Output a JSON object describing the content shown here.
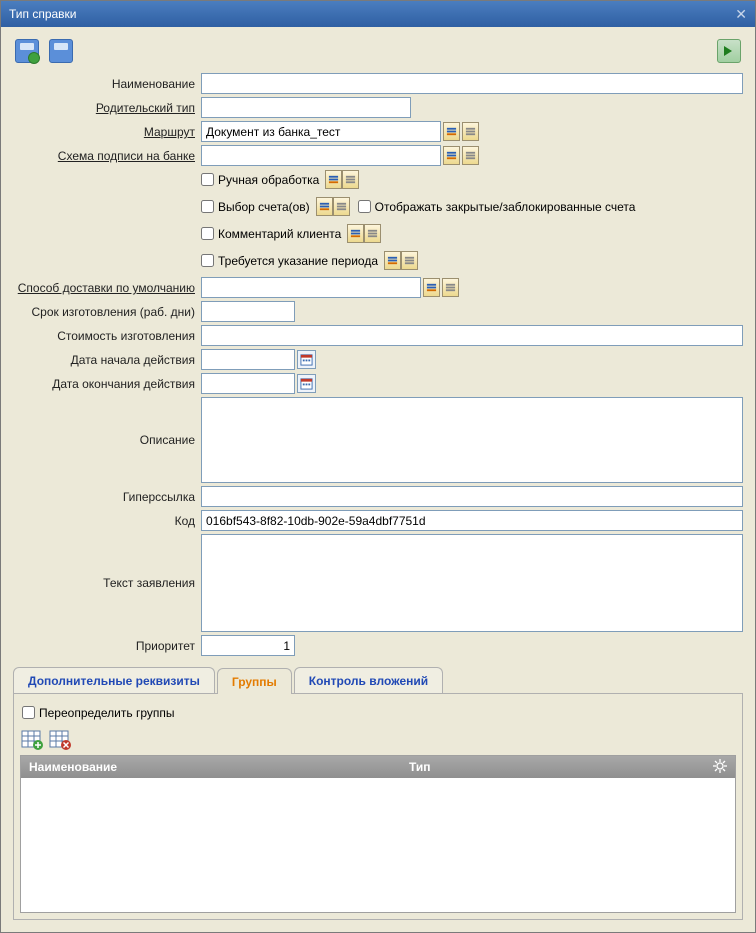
{
  "window": {
    "title": "Тип справки"
  },
  "labels": {
    "name": "Наименование",
    "parent_type": "Родительский тип",
    "route": "Маршрут",
    "signature_scheme": "Схема подписи на банке",
    "manual_processing": "Ручная обработка",
    "account_selection": "Выбор счета(ов)",
    "show_closed": "Отображать закрытые/заблокированные счета",
    "client_comment": "Комментарий клиента",
    "period_required": "Требуется указание периода",
    "delivery_method": "Способ доставки по умолчанию",
    "prod_time": "Срок изготовления (раб. дни)",
    "prod_cost": "Стоимость изготовления",
    "start_date": "Дата начала действия",
    "end_date": "Дата окончания действия",
    "description": "Описание",
    "hyperlink": "Гиперссылка",
    "code": "Код",
    "statement_text": "Текст заявления",
    "priority": "Приоритет",
    "override_groups": "Переопределить группы"
  },
  "values": {
    "name": "",
    "parent_type": "",
    "route": "Документ из банка_тест",
    "signature_scheme": "",
    "delivery_method": "",
    "prod_time": "",
    "prod_cost": "",
    "start_date": "",
    "end_date": "",
    "description": "",
    "hyperlink": "",
    "code": "016bf543-8f82-10db-902e-59a4dbf7751d",
    "statement_text": "",
    "priority": "1"
  },
  "tabs": {
    "extra": "Дополнительные реквизиты",
    "groups": "Группы",
    "attach": "Контроль вложений"
  },
  "grid": {
    "col_name": "Наименование",
    "col_type": "Тип"
  }
}
